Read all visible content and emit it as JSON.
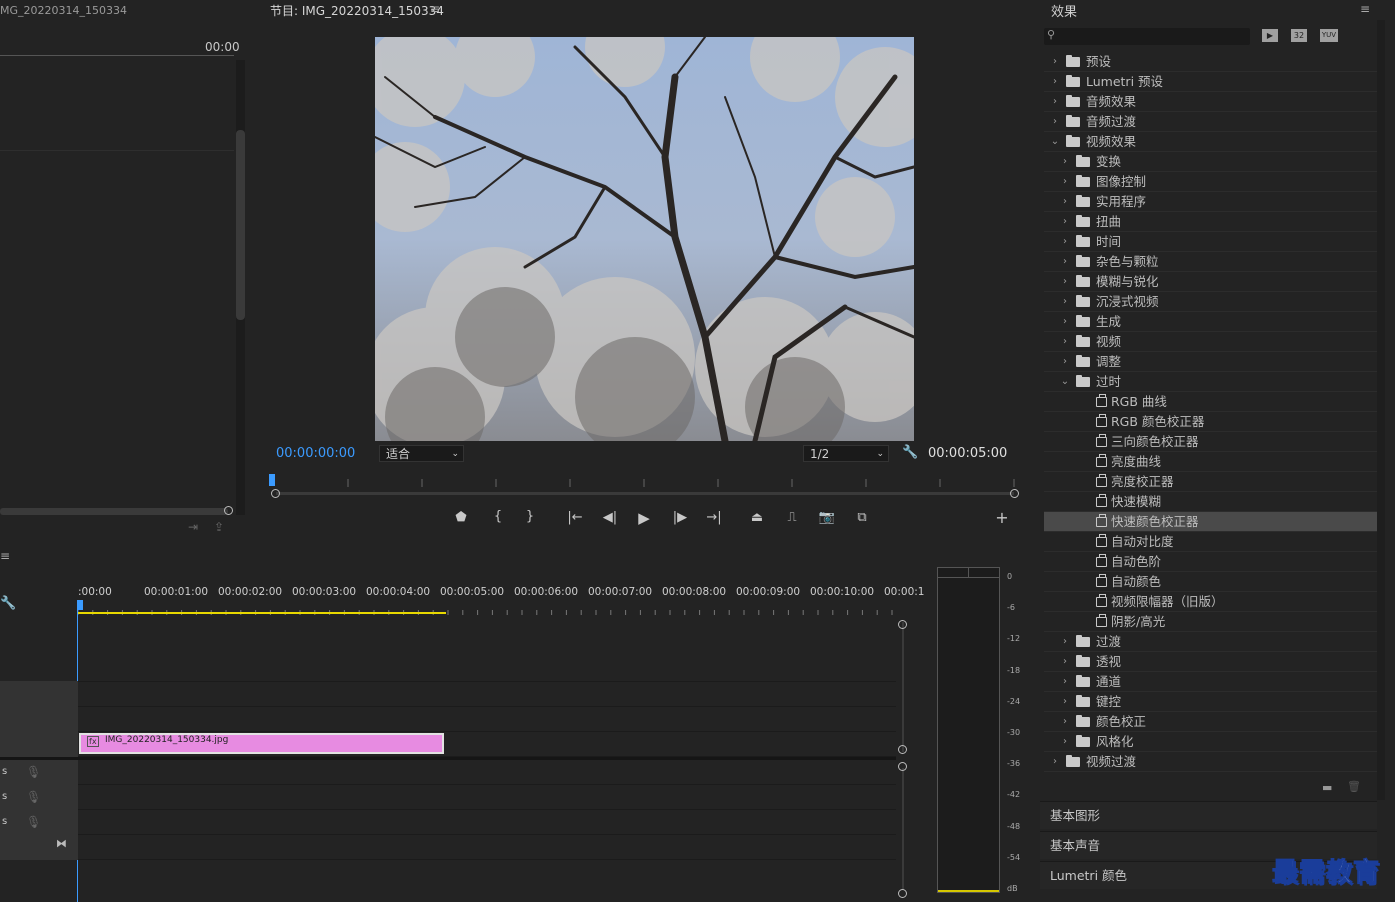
{
  "source": {
    "title": "MG_20220314_150334",
    "timecode": "00:00"
  },
  "program": {
    "title": "节目: IMG_20220314_150334",
    "menu_icon": "hamburger-icon",
    "current_time": "00:00:00:00",
    "fit_select": "适合",
    "resolution_select": "1/2",
    "duration": "00:00:05:00"
  },
  "timeline": {
    "ruler_labels": [
      ":00:00",
      "00:00:01:00",
      "00:00:02:00",
      "00:00:03:00",
      "00:00:04:00",
      "00:00:05:00",
      "00:00:06:00",
      "00:00:07:00",
      "00:00:08:00",
      "00:00:09:00",
      "00:00:10:00",
      "00:00:1"
    ],
    "clip_name": "IMG_20220314_150334.jpg",
    "clip_color": "#e78be1",
    "audio_track_labels": [
      "s",
      "s",
      "s"
    ]
  },
  "meter": {
    "scale": [
      "0",
      "-6",
      "-12",
      "-18",
      "-24",
      "-30",
      "-36",
      "-42",
      "-48",
      "-54",
      "dB"
    ]
  },
  "effects": {
    "title": "效果",
    "search_placeholder": "",
    "filter_icons": [
      "32",
      "YUV"
    ],
    "tree": [
      {
        "label": "预设",
        "type": "preset-folder",
        "level": 0,
        "open": false
      },
      {
        "label": "Lumetri 预设",
        "type": "preset-folder",
        "level": 0,
        "open": false
      },
      {
        "label": "音频效果",
        "type": "folder",
        "level": 0,
        "open": false
      },
      {
        "label": "音频过渡",
        "type": "folder",
        "level": 0,
        "open": false
      },
      {
        "label": "视频效果",
        "type": "folder",
        "level": 0,
        "open": true
      },
      {
        "label": "变换",
        "type": "folder",
        "level": 1,
        "open": false
      },
      {
        "label": "图像控制",
        "type": "folder",
        "level": 1,
        "open": false
      },
      {
        "label": "实用程序",
        "type": "folder",
        "level": 1,
        "open": false
      },
      {
        "label": "扭曲",
        "type": "folder",
        "level": 1,
        "open": false
      },
      {
        "label": "时间",
        "type": "folder",
        "level": 1,
        "open": false
      },
      {
        "label": "杂色与颗粒",
        "type": "folder",
        "level": 1,
        "open": false
      },
      {
        "label": "模糊与锐化",
        "type": "folder",
        "level": 1,
        "open": false
      },
      {
        "label": "沉浸式视频",
        "type": "folder",
        "level": 1,
        "open": false
      },
      {
        "label": "生成",
        "type": "folder",
        "level": 1,
        "open": false
      },
      {
        "label": "视频",
        "type": "folder",
        "level": 1,
        "open": false
      },
      {
        "label": "调整",
        "type": "folder",
        "level": 1,
        "open": false
      },
      {
        "label": "过时",
        "type": "folder",
        "level": 1,
        "open": true
      },
      {
        "label": "RGB 曲线",
        "type": "effect",
        "level": 2
      },
      {
        "label": "RGB 颜色校正器",
        "type": "effect",
        "level": 2
      },
      {
        "label": "三向颜色校正器",
        "type": "effect",
        "level": 2
      },
      {
        "label": "亮度曲线",
        "type": "effect",
        "level": 2
      },
      {
        "label": "亮度校正器",
        "type": "effect",
        "level": 2
      },
      {
        "label": "快速模糊",
        "type": "effect",
        "level": 2
      },
      {
        "label": "快速颜色校正器",
        "type": "effect",
        "level": 2,
        "selected": true
      },
      {
        "label": "自动对比度",
        "type": "effect",
        "level": 2
      },
      {
        "label": "自动色阶",
        "type": "effect",
        "level": 2
      },
      {
        "label": "自动颜色",
        "type": "effect",
        "level": 2
      },
      {
        "label": "视频限幅器（旧版）",
        "type": "effect",
        "level": 2
      },
      {
        "label": "阴影/高光",
        "type": "effect",
        "level": 2
      },
      {
        "label": "过渡",
        "type": "folder",
        "level": 1,
        "open": false
      },
      {
        "label": "透视",
        "type": "folder",
        "level": 1,
        "open": false
      },
      {
        "label": "通道",
        "type": "folder",
        "level": 1,
        "open": false
      },
      {
        "label": "键控",
        "type": "folder",
        "level": 1,
        "open": false
      },
      {
        "label": "颜色校正",
        "type": "folder",
        "level": 1,
        "open": false
      },
      {
        "label": "风格化",
        "type": "folder",
        "level": 1,
        "open": false
      },
      {
        "label": "视频过渡",
        "type": "folder",
        "level": 0,
        "open": false
      }
    ],
    "sections": [
      "基本图形",
      "基本声音",
      "Lumetri 颜色"
    ]
  },
  "watermark": "最需教育"
}
